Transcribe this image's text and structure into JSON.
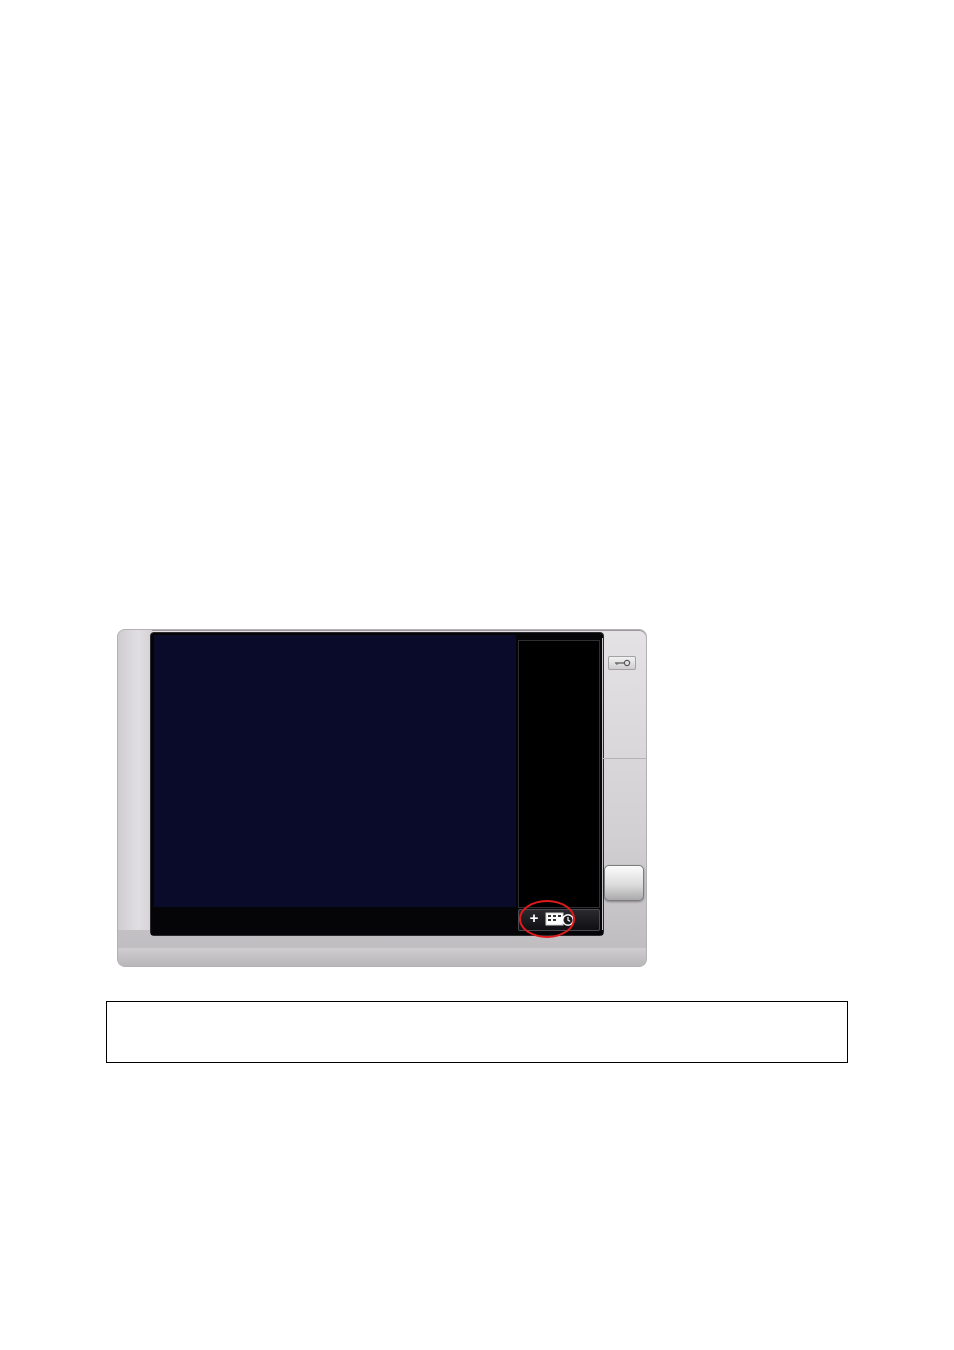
{
  "device": {
    "screen_color": "#0a0b2b",
    "toolbar": {
      "plus_icon": "plus-icon",
      "clock_icon": "schedule-clock-icon"
    },
    "settings_icon": "key-icon"
  },
  "annotation": {
    "highlight_color": "#e01a1a"
  },
  "caption": {
    "text": ""
  }
}
